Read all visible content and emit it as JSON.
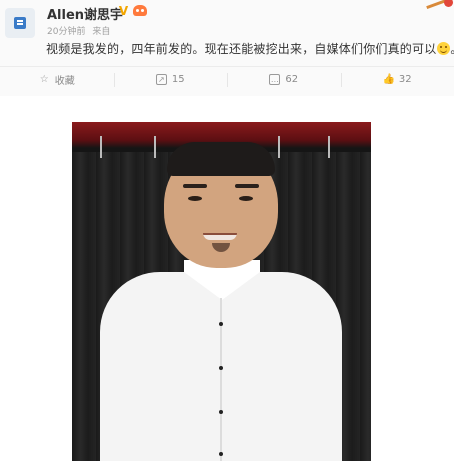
{
  "post": {
    "username": "Allen谢思宇",
    "vip_badge": "V",
    "time": "20分钟前",
    "source": "来自",
    "text": "视频是我发的，四年前发的。现在还能被挖出来，自媒体们你们真的可以",
    "text_end": "。",
    "icons": {
      "avatar": "weibo-app-avatar",
      "member": "member-crown-icon",
      "smiley": "smiley-emoji"
    }
  },
  "actions": [
    {
      "name": "favorite",
      "icon": "star-icon",
      "label": "收藏"
    },
    {
      "name": "repost",
      "icon": "share-icon",
      "label": "15"
    },
    {
      "name": "comment",
      "icon": "comment-icon",
      "label": "62"
    },
    {
      "name": "like",
      "icon": "thumbs-up-icon",
      "label": "32"
    }
  ],
  "colors": {
    "accent": "#f2a600",
    "member": "#ff7a3d",
    "text": "#333333",
    "muted": "#8a8a8a"
  },
  "photo": {
    "subject": "man-in-white-shirt-photo"
  }
}
